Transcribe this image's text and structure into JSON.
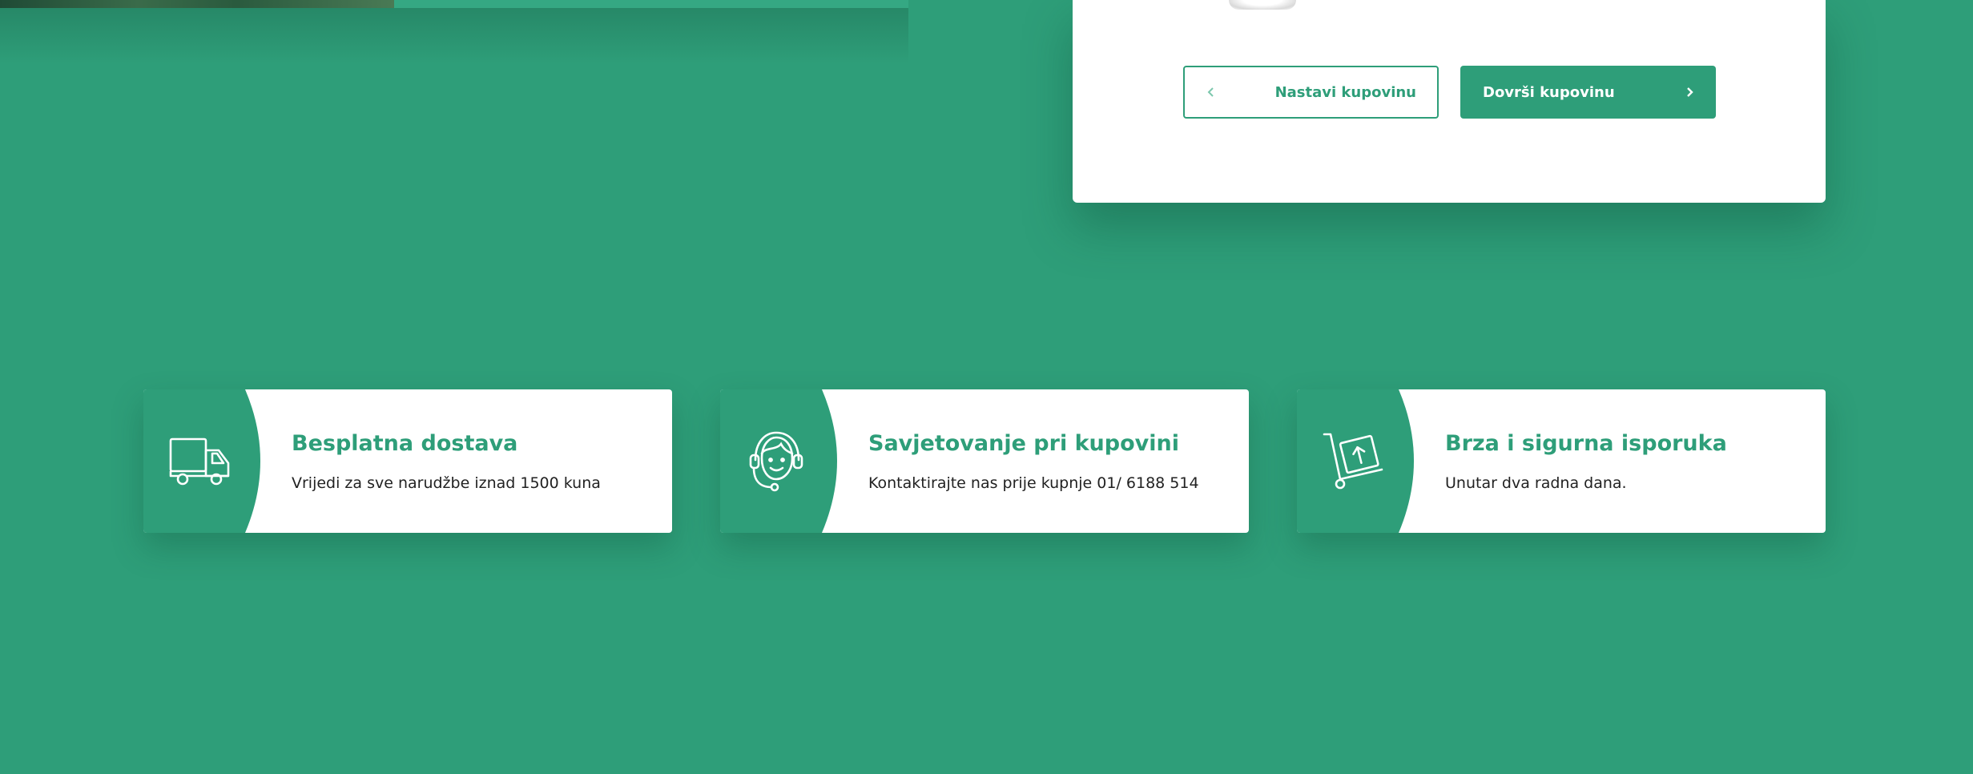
{
  "cart": {
    "continue_label": "Nastavi kupovinu",
    "finish_label": "Dovrši kupovinu"
  },
  "features": [
    {
      "icon": "delivery-truck-icon",
      "title": "Besplatna dostava",
      "description": "Vrijedi za sve narudžbe iznad 1500 kuna"
    },
    {
      "icon": "customer-support-headset-icon",
      "title": "Savjetovanje pri kupovini",
      "description": "Kontaktirajte nas prije kupnje 01/ 6188 514"
    },
    {
      "icon": "hand-truck-box-icon",
      "title": "Brza i sigurna isporuka",
      "description": "Unutar dva radna dana."
    }
  ],
  "colors": {
    "brand_green": "#2e9e79",
    "card_white": "#ffffff",
    "text_dark": "#222222"
  }
}
